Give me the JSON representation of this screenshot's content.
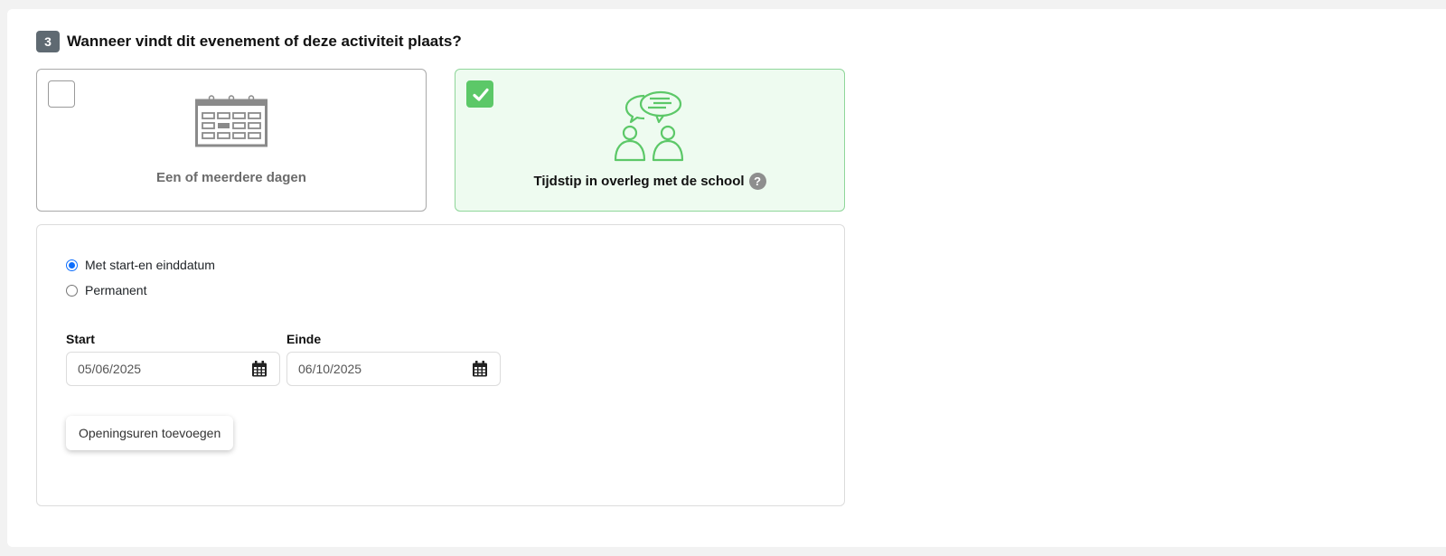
{
  "question": {
    "number": "3",
    "text": "Wanneer vindt dit evenement of deze activiteit plaats?"
  },
  "options": [
    {
      "label": "Een of meerdere dagen",
      "checked": false,
      "icon": "calendar-icon"
    },
    {
      "label": "Tijdstip in overleg met de school",
      "checked": true,
      "icon": "discussion-icon",
      "help": "?"
    }
  ],
  "date_mode": {
    "options": [
      {
        "label": "Met start-en einddatum",
        "selected": true
      },
      {
        "label": "Permanent",
        "selected": false
      }
    ]
  },
  "dates": {
    "start_label": "Start",
    "start_value": "05/06/2025",
    "end_label": "Einde",
    "end_value": "06/10/2025"
  },
  "add_hours_label": "Openingsuren toevoegen",
  "colors": {
    "accent_green": "#5cc868",
    "selected_bg": "#eefbf0",
    "radio_blue": "#0d6efd",
    "badge": "#5f6a72"
  }
}
